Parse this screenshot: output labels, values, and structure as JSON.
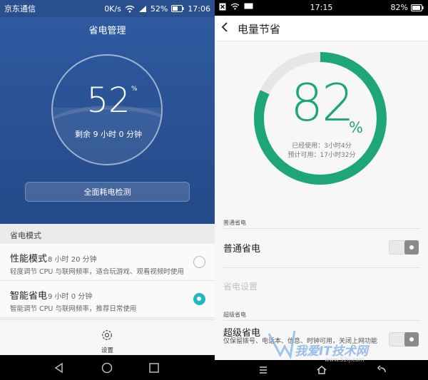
{
  "left": {
    "status": {
      "carrier": "京东通信",
      "speed": "0K/s",
      "battery": "52%",
      "time": "17:06"
    },
    "title": "省电管理",
    "percent": "52",
    "percent_sign": "%",
    "remaining": "剩余 9 小时 0 分钟",
    "detect_button": "全面耗电检测",
    "section_title": "省电模式",
    "modes": [
      {
        "name": "性能模式",
        "time": "8 小时 20 分钟",
        "desc": "轻度调节 CPU 与联网频率，适合玩游戏、观看视频时使用",
        "selected": false
      },
      {
        "name": "智能省电",
        "time": "9 小时 0 分钟",
        "desc": "智能调节 CPU 与联网频率，推荐日常使用",
        "selected": true
      }
    ],
    "settings_label": "设置",
    "colors": {
      "hero": "#2f5aa0",
      "accent": "#1fb9c0"
    }
  },
  "right": {
    "status": {
      "time": "17:15",
      "battery": "82%"
    },
    "title": "电量节省",
    "back_icon": "chevron-left-icon",
    "gauge_level": 0.82,
    "percent": "82",
    "percent_sign": "%",
    "used": "已经使用：3小时4分",
    "available": "预计可用：17小时32分",
    "normal_section": "普通省电",
    "normal_label": "普通省电",
    "normal_settings": "省电设置",
    "super_section": "超级省电",
    "super_label": "超级省电",
    "super_desc": "仅保留拨号、电话本、信息、时钟可用，关闭上网功能",
    "colors": {
      "accent": "#1ea57a",
      "track": "#e6e6e6"
    }
  },
  "watermark": {
    "text": "我爱IT技术网",
    "url": "www.52ij.com"
  }
}
